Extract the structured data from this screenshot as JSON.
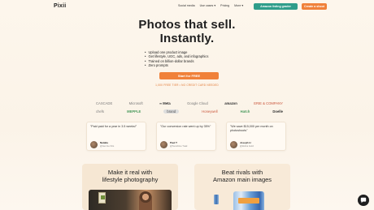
{
  "nav": {
    "logo": "Pixii",
    "links": [
      "Social media",
      "Use cases ▾",
      "Pricing",
      "More ▾"
    ],
    "green_button": "Amazon listing grader",
    "orange_button": "Create a shoot"
  },
  "hero": {
    "title_line1": "Photos that sell.",
    "title_line2": "Instantly.",
    "bullets": [
      "Upload one product image",
      "Get lifestyle, UGC, ads, and infographics",
      "Trained on billion-dollar brands",
      "Zero prompts"
    ],
    "cta": "Start for FREE",
    "cta_note": "1,000 FREE TIER • NO CREDIT CARD NEEDED"
  },
  "logos": {
    "row1": [
      "CASCADE",
      "Microsoft",
      "∞ Meta",
      "Google Cloud",
      "amazon",
      "ERIE & COMPANY"
    ],
    "row2": [
      "chefs",
      "MEPPLE",
      "brand",
      "Honeywell",
      "Hatch",
      "Doelle"
    ]
  },
  "testimonials": [
    {
      "quote": "\"Paid paid for a year in 3.5 weeks!\"",
      "name": "Natalia",
      "handle": "@Get Go Kits"
    },
    {
      "quote": "\"Our conversion rate went up by 35%\"",
      "name": "Paul T",
      "handle": "@Sunshine Tuak"
    },
    {
      "quote": "\"We save $15,000 per month on photoshoots\"",
      "name": "Joseph H",
      "handle": "@Zebra Gold"
    }
  ],
  "panels": {
    "left_line1": "Make it real with",
    "left_line2": "lifestyle photography",
    "right_line1": "Beat rivals with",
    "right_line2": "Amazon main images"
  },
  "chat_icon": "chat-bubble-icon",
  "colors": {
    "green": "#2f9d8a",
    "orange": "#f0813a"
  }
}
